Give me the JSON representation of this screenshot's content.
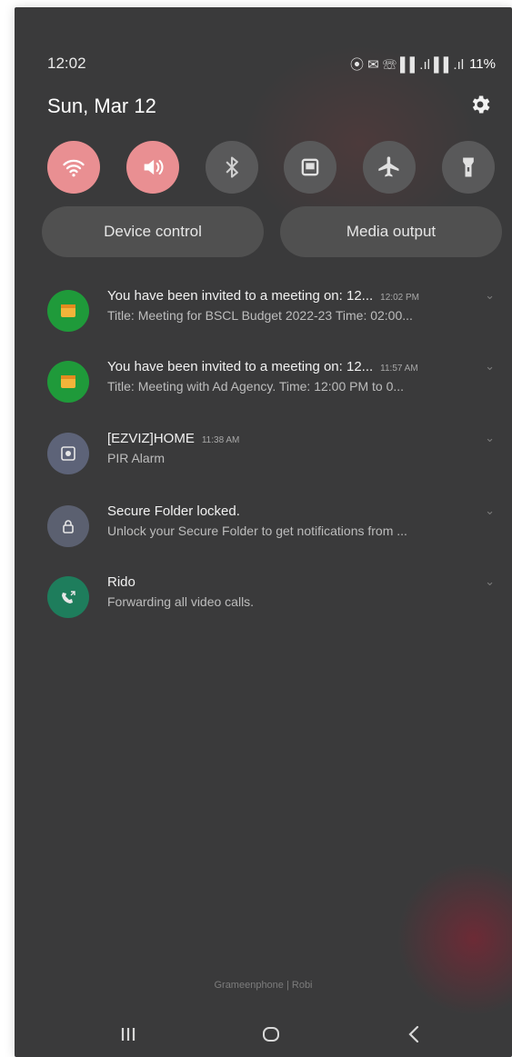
{
  "status_bar": {
    "time": "12:02",
    "battery": "11%",
    "signal_text": "⦿ ✉ ☏ ▌▌.ıl ▌▌.ıl"
  },
  "header": {
    "date": "Sun, Mar 12"
  },
  "quick_settings": {
    "tiles": [
      {
        "name": "wifi",
        "state": "on",
        "icon": "wifi-icon"
      },
      {
        "name": "sound",
        "state": "on",
        "icon": "speaker-icon"
      },
      {
        "name": "bluetooth",
        "state": "off",
        "icon": "bluetooth-icon"
      },
      {
        "name": "screen",
        "state": "off",
        "icon": "screen-icon"
      },
      {
        "name": "airplane",
        "state": "off",
        "icon": "airplane-icon"
      },
      {
        "name": "flashlight",
        "state": "off",
        "icon": "flashlight-icon"
      }
    ],
    "device_control_label": "Device control",
    "media_output_label": "Media output"
  },
  "notifications": [
    {
      "title": "You have been invited to a meeting on: 12...",
      "time": "12:02 PM",
      "body": "Title: Meeting for BSCL Budget 2022-23 Time: 02:00...",
      "icon": "calendar-icon",
      "icon_color": "#1f9a3a"
    },
    {
      "title": "You have been invited to a meeting on: 12...",
      "time": "11:57 AM",
      "body": "Title: Meeting with Ad Agency. Time: 12:00 PM to 0...",
      "icon": "calendar-icon",
      "icon_color": "#1f9a3a"
    },
    {
      "title": "[EZVIZ]HOME",
      "time": "11:38 AM",
      "body": "PIR Alarm",
      "icon": "camera-icon",
      "icon_color": "#5d6378"
    },
    {
      "title": "Secure Folder locked.",
      "time": "",
      "body": "Unlock your Secure Folder to get notifications from ...",
      "icon": "lock-icon",
      "icon_color": "#5b6070"
    },
    {
      "title": "Rido",
      "time": "",
      "body": "Forwarding all video calls.",
      "icon": "call-forward-icon",
      "icon_color": "#1e7d5c"
    }
  ],
  "footer": {
    "text": "Grameenphone | Robi"
  },
  "colors": {
    "panel": "#3a3a3b",
    "tile_on": "#e98f92",
    "tile_off": "#59595a"
  }
}
